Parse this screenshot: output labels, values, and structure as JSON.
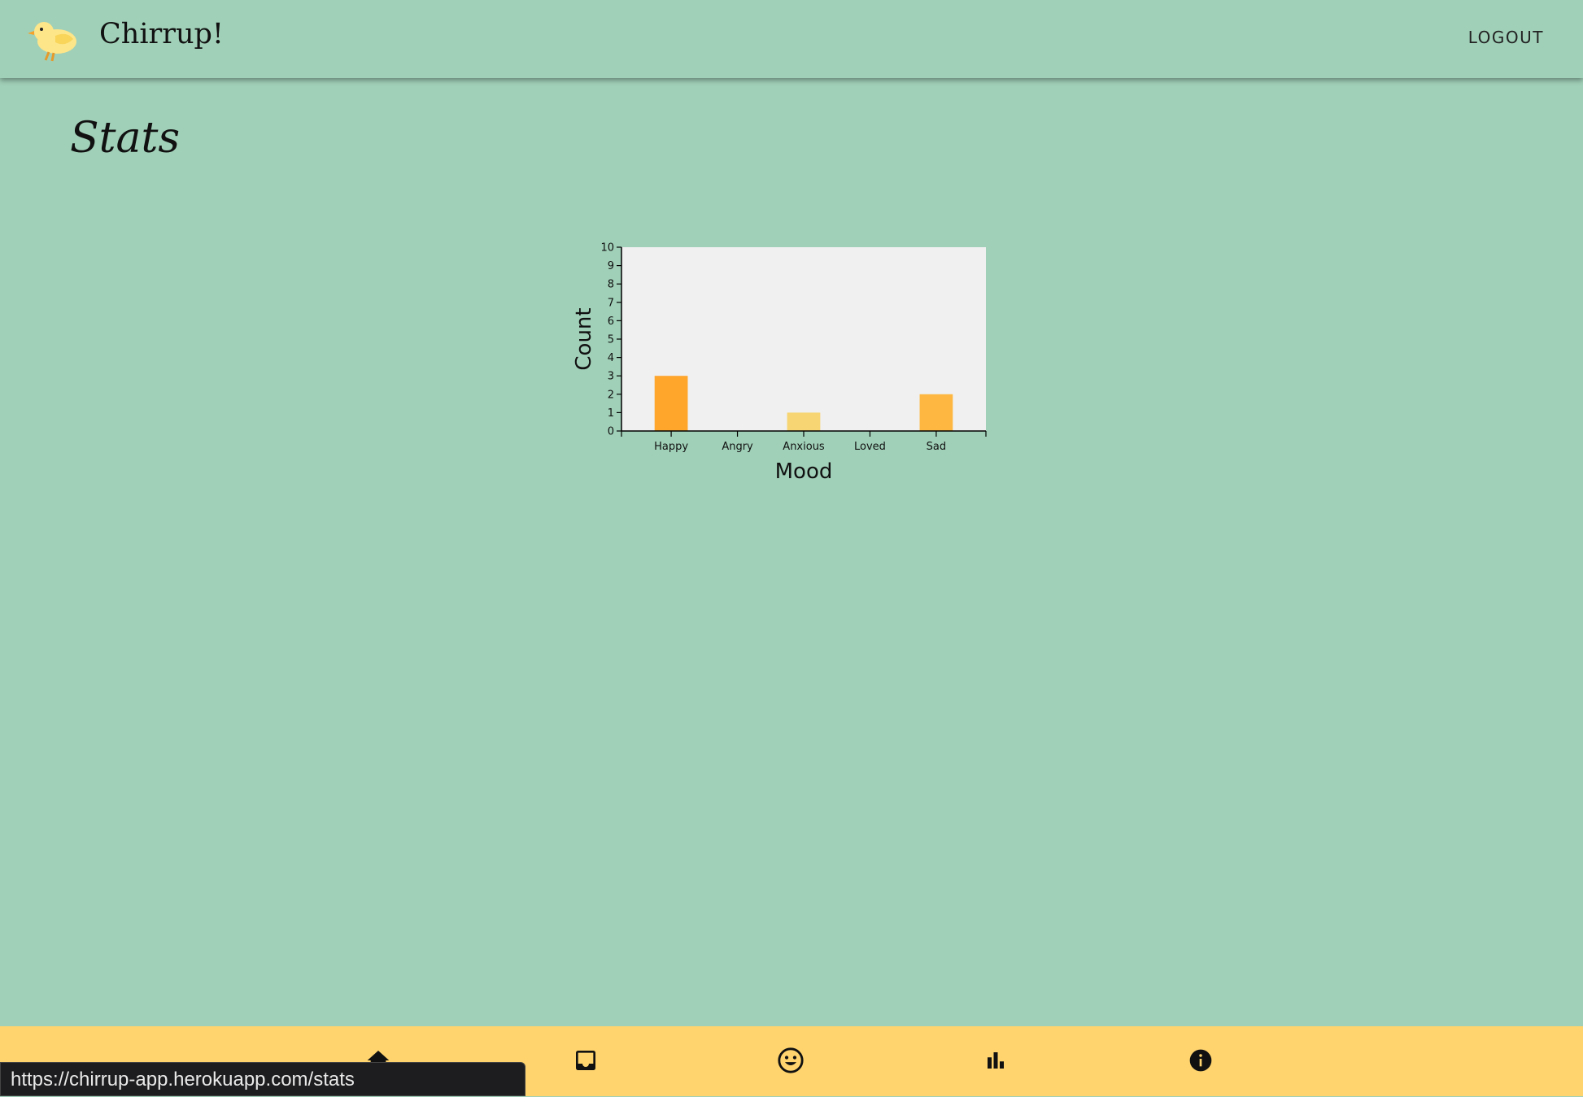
{
  "header": {
    "app_title": "Chirrup!",
    "logout_label": "LOGOUT"
  },
  "page": {
    "heading": "Stats"
  },
  "chart_data": {
    "type": "bar",
    "categories": [
      "Happy",
      "Angry",
      "Anxious",
      "Loved",
      "Sad"
    ],
    "values": [
      3,
      0,
      1,
      0,
      2
    ],
    "bar_colors": [
      "#ffa62b",
      "#ffa62b",
      "#f7d572",
      "#ffa62b",
      "#feb842"
    ],
    "xlabel": "Mood",
    "ylabel": "Count",
    "ylim": [
      0,
      10
    ],
    "yticks": [
      0,
      1,
      2,
      3,
      4,
      5,
      6,
      7,
      8,
      9,
      10
    ],
    "plot_background": "#f0f0f0",
    "grid": false
  },
  "bottom_nav": {
    "items": [
      {
        "icon": "home-icon"
      },
      {
        "icon": "inbox-icon"
      },
      {
        "icon": "smiley-icon"
      },
      {
        "icon": "bar-chart-icon"
      },
      {
        "icon": "info-icon"
      }
    ]
  },
  "status_bar": {
    "url": "https://chirrup-app.herokuapp.com/stats"
  },
  "colors": {
    "background": "#a0d0b8",
    "nav_background": "#ffd46e"
  }
}
